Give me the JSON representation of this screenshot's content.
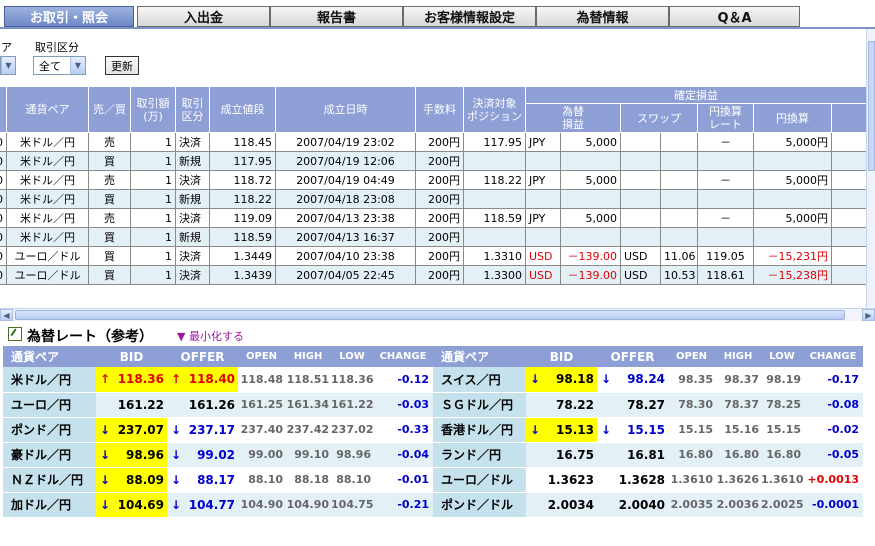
{
  "tabs": [
    "お取引・照会",
    "入出金",
    "報告書",
    "お客様情報設定",
    "為替情報",
    "Q＆A"
  ],
  "filter": {
    "label": "取引区分",
    "cutoff_label": "ア",
    "value": "全て",
    "update_button": "更新"
  },
  "trade_table": {
    "headers": {
      "pair": "通貨ペア",
      "side": "売／買",
      "amount": "取引額\n(万)",
      "kind": "取引\n区分",
      "price": "成立値段",
      "datetime": "成立日時",
      "fee": "手数料",
      "position": "決済対象\nポジション",
      "confirmed": "確定損益",
      "fx_pl": "為替\n損益",
      "swap": "スワップ",
      "yen_rate": "円換算\nレート",
      "yen": "円換算"
    },
    "rows": [
      {
        "lead": "0",
        "pair": "米ドル／円",
        "side": "売",
        "amount": "1",
        "kind": "決済",
        "price": "118.45",
        "datetime": "2007/04/19 23:02",
        "fee": "200円",
        "position": "117.95",
        "cur": "JPY",
        "fx_pl": "5,000",
        "swap_cur": "",
        "swap": "",
        "rate": "－",
        "yen": "5,000円"
      },
      {
        "lead": "0",
        "pair": "米ドル／円",
        "side": "買",
        "amount": "1",
        "kind": "新規",
        "price": "117.95",
        "datetime": "2007/04/19 12:06",
        "fee": "200円",
        "position": "",
        "cur": "",
        "fx_pl": "",
        "swap_cur": "",
        "swap": "",
        "rate": "",
        "yen": ""
      },
      {
        "lead": "0",
        "pair": "米ドル／円",
        "side": "売",
        "amount": "1",
        "kind": "決済",
        "price": "118.72",
        "datetime": "2007/04/19 04:49",
        "fee": "200円",
        "position": "118.22",
        "cur": "JPY",
        "fx_pl": "5,000",
        "swap_cur": "",
        "swap": "",
        "rate": "－",
        "yen": "5,000円"
      },
      {
        "lead": "0",
        "pair": "米ドル／円",
        "side": "買",
        "amount": "1",
        "kind": "新規",
        "price": "118.22",
        "datetime": "2007/04/18 23:08",
        "fee": "200円",
        "position": "",
        "cur": "",
        "fx_pl": "",
        "swap_cur": "",
        "swap": "",
        "rate": "",
        "yen": ""
      },
      {
        "lead": "0",
        "pair": "米ドル／円",
        "side": "売",
        "amount": "1",
        "kind": "決済",
        "price": "119.09",
        "datetime": "2007/04/13 23:38",
        "fee": "200円",
        "position": "118.59",
        "cur": "JPY",
        "fx_pl": "5,000",
        "swap_cur": "",
        "swap": "",
        "rate": "－",
        "yen": "5,000円"
      },
      {
        "lead": "0",
        "pair": "米ドル／円",
        "side": "買",
        "amount": "1",
        "kind": "新規",
        "price": "118.59",
        "datetime": "2007/04/13 16:37",
        "fee": "200円",
        "position": "",
        "cur": "",
        "fx_pl": "",
        "swap_cur": "",
        "swap": "",
        "rate": "",
        "yen": ""
      },
      {
        "lead": "0",
        "pair": "ユーロ／ドル",
        "side": "買",
        "amount": "1",
        "kind": "決済",
        "price": "1.3449",
        "datetime": "2007/04/10 23:38",
        "fee": "200円",
        "position": "1.3310",
        "cur": "USD",
        "fx_pl": "－139.00",
        "swap_cur": "USD",
        "swap": "11.06",
        "rate": "119.05",
        "yen": "－15,231円"
      },
      {
        "lead": "0",
        "pair": "ユーロ／ドル",
        "side": "買",
        "amount": "1",
        "kind": "決済",
        "price": "1.3439",
        "datetime": "2007/04/05 22:45",
        "fee": "200円",
        "position": "1.3300",
        "cur": "USD",
        "fx_pl": "－139.00",
        "swap_cur": "USD",
        "swap": "10.53",
        "rate": "118.61",
        "yen": "－15,238円"
      }
    ]
  },
  "rate_panel": {
    "title": "為替レート（参考）",
    "minimize": "▼ 最小化する",
    "headers": [
      "通貨ペア",
      "BID",
      "OFFER",
      "OPEN",
      "HIGH",
      "LOW",
      "CHANGE"
    ],
    "left": [
      {
        "pair": "米ドル／円",
        "bid_arrow": "↑",
        "bid": "118.36",
        "offer_arrow": "↑",
        "offer": "118.40",
        "open": "118.48",
        "high": "118.51",
        "low": "118.36",
        "change": "-0.12",
        "dir": "up",
        "hl": true
      },
      {
        "pair": "ユーロ／円",
        "bid_arrow": "",
        "bid": "161.22",
        "offer_arrow": "",
        "offer": "161.26",
        "open": "161.25",
        "high": "161.34",
        "low": "161.22",
        "change": "-0.03",
        "dir": "blk",
        "hl": false
      },
      {
        "pair": "ポンド／円",
        "bid_arrow": "↓",
        "bid": "237.07",
        "offer_arrow": "↓",
        "offer": "237.17",
        "open": "237.40",
        "high": "237.42",
        "low": "237.02",
        "change": "-0.33",
        "dir": "down",
        "hl": true
      },
      {
        "pair": "豪ドル／円",
        "bid_arrow": "↓",
        "bid": "98.96",
        "offer_arrow": "↓",
        "offer": "99.02",
        "open": "99.00",
        "high": "99.10",
        "low": "98.96",
        "change": "-0.04",
        "dir": "down",
        "hl": true
      },
      {
        "pair": "ＮＺドル／円",
        "bid_arrow": "↓",
        "bid": "88.09",
        "offer_arrow": "↓",
        "offer": "88.17",
        "open": "88.10",
        "high": "88.18",
        "low": "88.10",
        "change": "-0.01",
        "dir": "down",
        "hl": true
      },
      {
        "pair": "加ドル／円",
        "bid_arrow": "↓",
        "bid": "104.69",
        "offer_arrow": "↓",
        "offer": "104.77",
        "open": "104.90",
        "high": "104.90",
        "low": "104.75",
        "change": "-0.21",
        "dir": "down",
        "hl": true
      }
    ],
    "right": [
      {
        "pair": "スイス／円",
        "bid_arrow": "↓",
        "bid": "98.18",
        "offer_arrow": "↓",
        "offer": "98.24",
        "open": "98.35",
        "high": "98.37",
        "low": "98.19",
        "change": "-0.17",
        "dir": "down",
        "hl": true
      },
      {
        "pair": "ＳＧドル／円",
        "bid_arrow": "",
        "bid": "78.22",
        "offer_arrow": "",
        "offer": "78.27",
        "open": "78.30",
        "high": "78.37",
        "low": "78.25",
        "change": "-0.08",
        "dir": "blk",
        "hl": false
      },
      {
        "pair": "香港ドル／円",
        "bid_arrow": "↓",
        "bid": "15.13",
        "offer_arrow": "↓",
        "offer": "15.15",
        "open": "15.15",
        "high": "15.16",
        "low": "15.15",
        "change": "-0.02",
        "dir": "down",
        "hl": true
      },
      {
        "pair": "ランド／円",
        "bid_arrow": "",
        "bid": "16.75",
        "offer_arrow": "",
        "offer": "16.81",
        "open": "16.80",
        "high": "16.80",
        "low": "16.80",
        "change": "-0.05",
        "dir": "blk",
        "hl": false
      },
      {
        "pair": "ユーロ／ドル",
        "bid_arrow": "",
        "bid": "1.3623",
        "offer_arrow": "",
        "offer": "1.3628",
        "open": "1.3610",
        "high": "1.3626",
        "low": "1.3610",
        "change": "+0.0013",
        "dir": "blk",
        "hl": false
      },
      {
        "pair": "ポンド／ドル",
        "bid_arrow": "",
        "bid": "2.0034",
        "offer_arrow": "",
        "offer": "2.0040",
        "open": "2.0035",
        "high": "2.0036",
        "low": "2.0025",
        "change": "-0.0001",
        "dir": "blk",
        "hl": false
      }
    ]
  },
  "colors": {
    "header": "#8e9fd6",
    "row_alt": "#e3f1f6",
    "highlight": "#ffff00",
    "up": "#e00000",
    "down": "#0000cc"
  }
}
